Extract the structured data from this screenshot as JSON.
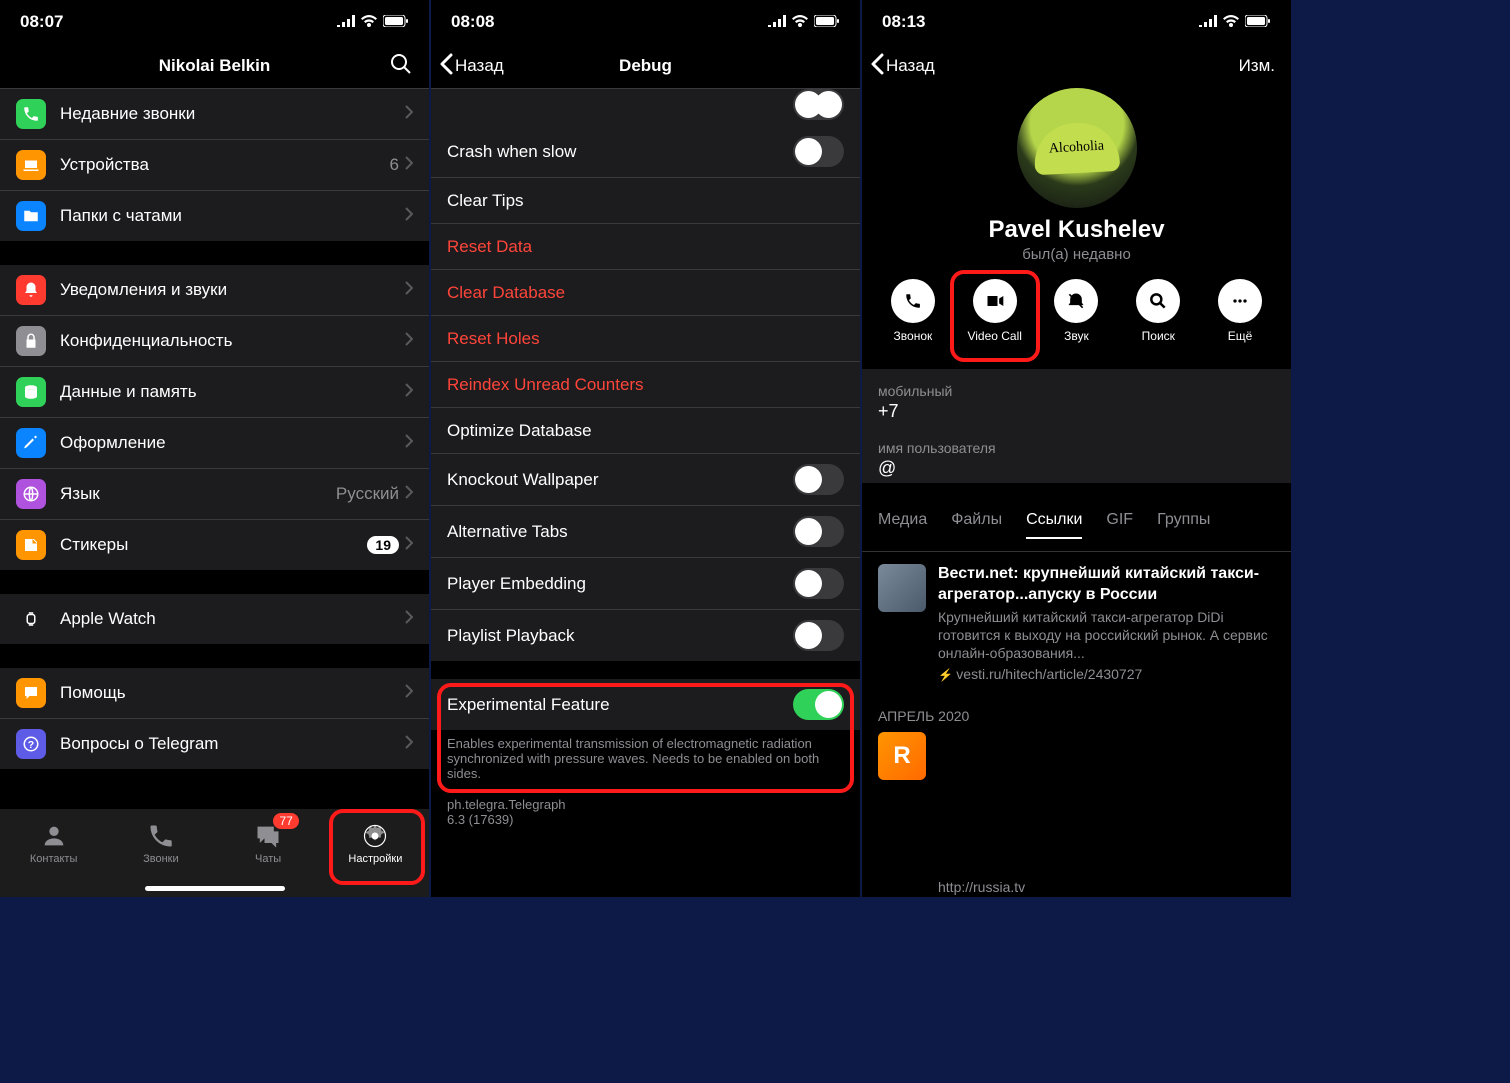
{
  "phone1": {
    "time": "08:07",
    "title": "Nikolai Belkin",
    "rows_top": [
      {
        "label": "Недавние звонки",
        "icon": "phone",
        "color": "#30d158"
      },
      {
        "label": "Устройства",
        "icon": "laptop",
        "color": "#ff9500",
        "detail": "6"
      },
      {
        "label": "Папки с чатами",
        "icon": "folder",
        "color": "#0a84ff"
      }
    ],
    "rows_g2": [
      {
        "label": "Уведомления и звуки",
        "icon": "bell",
        "color": "#ff3b30"
      },
      {
        "label": "Конфиденциальность",
        "icon": "lock",
        "color": "#8e8e93"
      },
      {
        "label": "Данные и память",
        "icon": "data",
        "color": "#30d158"
      },
      {
        "label": "Оформление",
        "icon": "brush",
        "color": "#0a84ff"
      },
      {
        "label": "Язык",
        "icon": "globe",
        "color": "#af52de",
        "detail": "Русский"
      },
      {
        "label": "Стикеры",
        "icon": "sticker",
        "color": "#ff9500",
        "badge": "19"
      }
    ],
    "rows_g3": [
      {
        "label": "Apple Watch",
        "icon": "watch",
        "color": "#1c1c1e"
      }
    ],
    "rows_g4": [
      {
        "label": "Помощь",
        "icon": "chat",
        "color": "#ff9500"
      },
      {
        "label": "Вопросы о Telegram",
        "icon": "faq",
        "color": "#5e5ce6"
      }
    ],
    "tabs": [
      {
        "label": "Контакты",
        "icon": "contacts"
      },
      {
        "label": "Звонки",
        "icon": "calls"
      },
      {
        "label": "Чаты",
        "icon": "chats",
        "badge": "77"
      },
      {
        "label": "Настройки",
        "icon": "settings",
        "active": true
      }
    ]
  },
  "phone2": {
    "time": "08:08",
    "back": "Назад",
    "title": "Debug",
    "rows": [
      {
        "label": "Crash when slow",
        "switch": false
      },
      {
        "label": "Clear Tips"
      },
      {
        "label": "Reset Data",
        "danger": true
      },
      {
        "label": "Clear Database",
        "danger": true
      },
      {
        "label": "Reset Holes",
        "danger": true
      },
      {
        "label": "Reindex Unread Counters",
        "danger": true
      },
      {
        "label": "Optimize Database"
      },
      {
        "label": "Knockout Wallpaper",
        "switch": false
      },
      {
        "label": "Alternative Tabs",
        "switch": false
      },
      {
        "label": "Player Embedding",
        "switch": false
      },
      {
        "label": "Playlist Playback",
        "switch": false
      }
    ],
    "exp": {
      "label": "Experimental Feature",
      "on": true
    },
    "exp_note": "Enables experimental transmission of electromagnetic radiation synchronized with pressure waves. Needs to be enabled on both sides.",
    "app_id": "ph.telegra.Telegraph",
    "app_ver": "6.3 (17639)"
  },
  "phone3": {
    "time": "08:13",
    "back": "Назад",
    "edit": "Изм.",
    "avatar_text": "Alcoholia",
    "name": "Pavel Kushelev",
    "status": "был(а) недавно",
    "actions": [
      {
        "label": "Звонок",
        "icon": "phone"
      },
      {
        "label": "Video Call",
        "icon": "video"
      },
      {
        "label": "Звук",
        "icon": "mute"
      },
      {
        "label": "Поиск",
        "icon": "search"
      },
      {
        "label": "Ещё",
        "icon": "more"
      }
    ],
    "mobile_label": "мобильный",
    "mobile_value": "+7",
    "username_label": "имя пользователя",
    "username_value": "@",
    "media_tabs": [
      "Медиа",
      "Файлы",
      "Ссылки",
      "GIF",
      "Группы"
    ],
    "media_active": 2,
    "link1": {
      "title": "Вести.net: крупнейший китайский такси-агрегатор...апуску в России",
      "desc": "Крупнейший китайский такси-агрегатор DiDi готовится к выходу на российский рынок. А сервис онлайн-образования...",
      "url": "vesti.ru/hitech/article/2430727"
    },
    "month": "АПРЕЛЬ 2020",
    "link2_letter": "R",
    "link2_url": "http://russia.tv"
  }
}
